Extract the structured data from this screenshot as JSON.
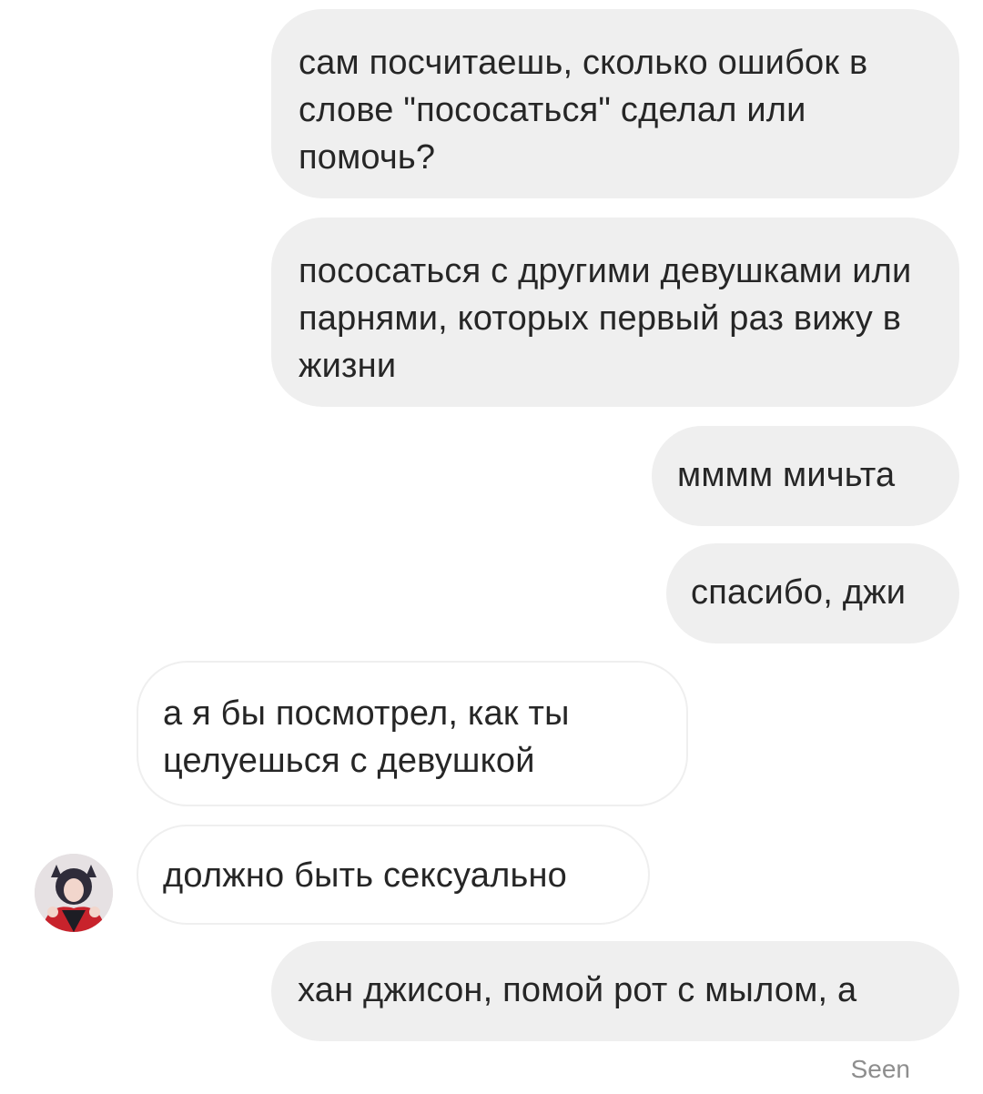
{
  "messages": [
    {
      "direction": "outgoing",
      "text": "сам посчитаешь, сколько ошибок в слове \"пососаться\" сделал или помочь?"
    },
    {
      "direction": "outgoing",
      "text": "пососаться с другими девушками или парнями, которых первый раз вижу в жизни"
    },
    {
      "direction": "outgoing",
      "text": "мммм мичьта"
    },
    {
      "direction": "outgoing",
      "text": "спасибо, джи"
    },
    {
      "direction": "incoming",
      "text": "а я бы посмотрел, как ты целуешься с девушкой"
    },
    {
      "direction": "incoming",
      "text": "должно быть сексуально"
    },
    {
      "direction": "outgoing",
      "text": "хан джисон, помой рот с мылом, а"
    }
  ],
  "status": {
    "seen_label": "Seen"
  },
  "colors": {
    "outgoing_bubble": "#efefef",
    "incoming_border": "#efefef",
    "text": "#262626",
    "seen": "#8e8e8e"
  },
  "icons": {
    "sender_avatar": "profile-photo"
  }
}
